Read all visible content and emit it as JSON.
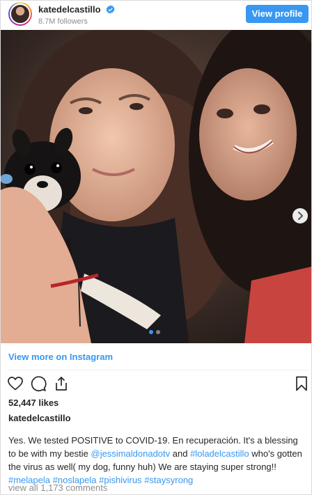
{
  "header": {
    "username": "katedelcastillo",
    "followers": "8.7M followers",
    "view_profile_label": "View profile"
  },
  "media": {
    "carousel_dots": 2,
    "active_dot": 0
  },
  "view_more_label": "View more on Instagram",
  "actions": {
    "icons": [
      "heart-icon",
      "comment-icon",
      "share-icon",
      "bookmark-icon"
    ]
  },
  "likes": "52,447 likes",
  "owner_name": "katedelcastillo",
  "caption": {
    "text_1": "Yes. We tested POSITIVE to COVID-19. En recuperación. It's a blessing to be with my bestie ",
    "mention_1": "@jessimaldonadotv",
    "text_2": " and ",
    "mention_2": "#loladelcastillo",
    "text_3": " who's gotten the virus as well( my dog, funny huh) We are staying super strong!! ",
    "tag_1": "#melapela",
    "tag_2": "#noslapela",
    "tag_3": "#pishivirus",
    "tag_4": "#staysyrong"
  },
  "comments": "view all 1,173 comments",
  "colors": {
    "accent": "#3897f0",
    "text": "#262626",
    "muted": "#8e8e8e",
    "border": "#dbdbdb"
  }
}
